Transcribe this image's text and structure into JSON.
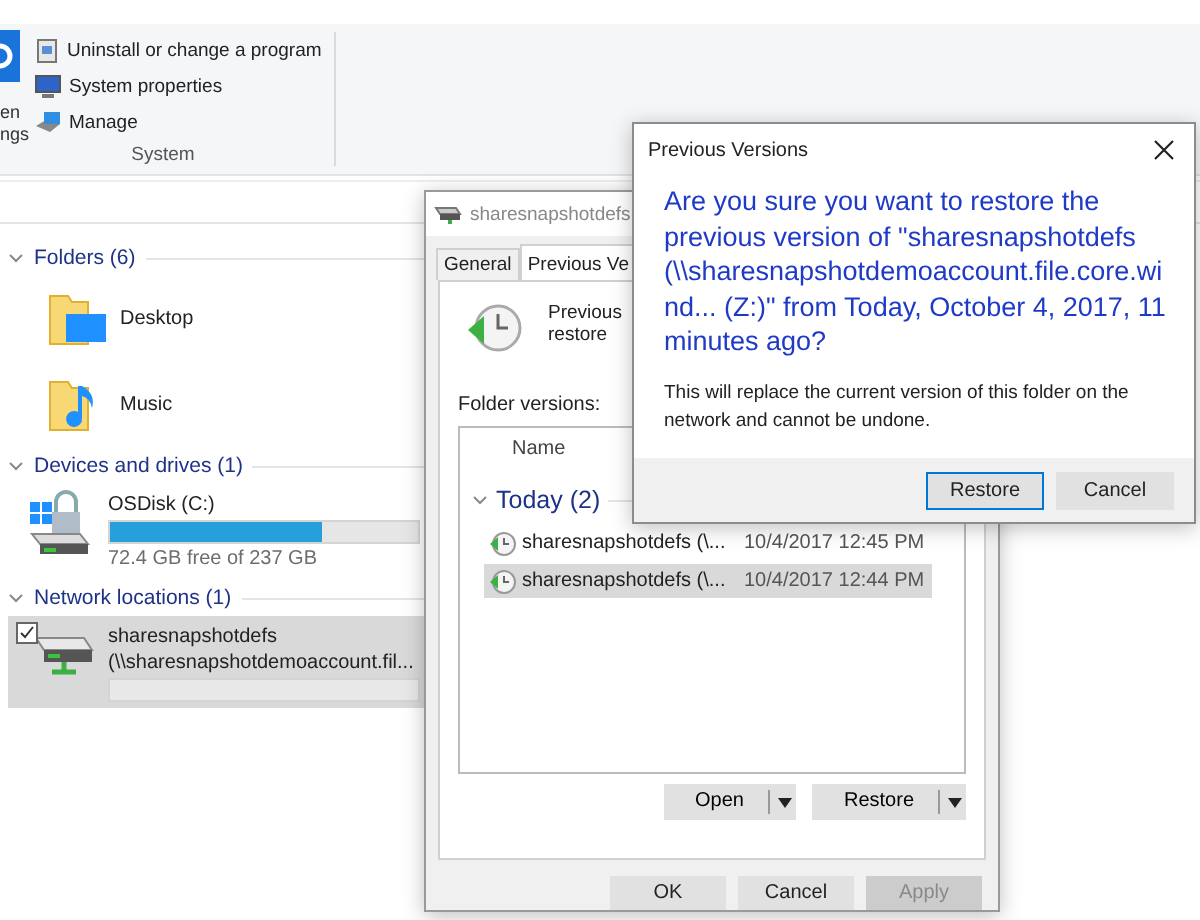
{
  "ribbon": {
    "cut_button_lines": [
      "en",
      "ngs"
    ],
    "items": [
      {
        "kind": "uninstall",
        "label": "Uninstall or change a program"
      },
      {
        "kind": "properties",
        "label": "System properties"
      },
      {
        "kind": "manage",
        "label": "Manage"
      }
    ],
    "group_label": "System"
  },
  "sections": [
    {
      "title": "Folders (6)",
      "expanded": true,
      "items": [
        {
          "kind": "desktop_folder",
          "name": "Desktop"
        },
        {
          "kind": "music_folder",
          "name": "Music"
        }
      ]
    },
    {
      "title": "Devices and drives (1)",
      "expanded": true,
      "items": [
        {
          "kind": "drive",
          "name": "OSDisk (C:)",
          "level": 0.69,
          "detail": "72.4 GB free of 237 GB",
          "selected": false,
          "checked": false
        }
      ]
    },
    {
      "title": "Network locations (1)",
      "expanded": true,
      "items": [
        {
          "kind": "network",
          "name": "sharesnapshotdefs",
          "path": "(\\\\sharesnapshotdemoaccount.fil...",
          "selected": true,
          "checked": true
        }
      ]
    }
  ],
  "properties": {
    "title": "sharesnapshotdefs",
    "tabs": [
      {
        "label": "General",
        "selected": false
      },
      {
        "label": "Previous Ve",
        "selected": true
      }
    ],
    "description_lines": [
      "Previous",
      "restore"
    ],
    "list_label": "Folder versions:",
    "column": "Name",
    "group": {
      "title": "Today (2)",
      "expanded": true,
      "rows": [
        {
          "name": "sharesnapshotdefs (\\...",
          "date": "10/4/2017 12:45 PM",
          "selected": false
        },
        {
          "name": "sharesnapshotdefs (\\...",
          "date": "10/4/2017 12:44 PM",
          "selected": true
        }
      ]
    },
    "split_buttons": [
      "Open",
      "Restore"
    ],
    "buttons": [
      {
        "label": "OK",
        "disabled": false
      },
      {
        "label": "Cancel",
        "disabled": false
      },
      {
        "label": "Apply",
        "disabled": true
      }
    ]
  },
  "confirm": {
    "title": "Previous Versions",
    "question": "Are you sure you want to restore the previous version of \"sharesnapshotdefs (\\\\sharesnapshotdemoaccount.file.core.wind... (Z:)\" from Today, October 4, 2017, 11 minutes ago?",
    "note": "This will replace the current version of this folder on the network and cannot be undone.",
    "buttons": [
      {
        "label": "Restore",
        "default": true
      },
      {
        "label": "Cancel",
        "default": false
      }
    ]
  }
}
